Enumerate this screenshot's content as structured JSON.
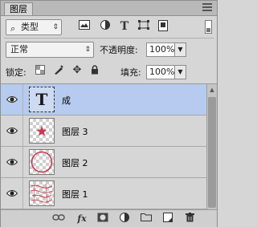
{
  "panel": {
    "tab_label": "图层"
  },
  "filter": {
    "kind_label": "类型",
    "icons": [
      "image-filter-icon",
      "adjustment-filter-icon",
      "type-filter-icon",
      "shape-filter-icon",
      "smart-object-filter-icon"
    ]
  },
  "blend": {
    "mode": "正常",
    "opacity_label": "不透明度:",
    "opacity_value": "100%"
  },
  "locks": {
    "label": "锁定:",
    "fill_label": "填充:",
    "fill_value": "100%",
    "icons": [
      "lock-transparent-pixels-icon",
      "lock-image-pixels-icon",
      "lock-position-icon",
      "lock-all-icon"
    ]
  },
  "layers": [
    {
      "name": "成",
      "type": "text",
      "thumb_glyph": "T",
      "selected": true,
      "visible": true
    },
    {
      "name": "图层 3",
      "type": "pixel",
      "selected": false,
      "visible": true
    },
    {
      "name": "图层 2",
      "type": "pixel",
      "selected": false,
      "visible": true
    },
    {
      "name": "图层 1",
      "type": "pixel",
      "selected": false,
      "visible": true
    }
  ],
  "bottom_icons": [
    "link-layers-icon",
    "fx-icon",
    "layer-mask-icon",
    "adjustment-layer-icon",
    "folder-icon",
    "new-layer-icon",
    "trash-icon"
  ],
  "colors": {
    "selection": "#b6cbef",
    "stamp_red": "#c8394f"
  }
}
